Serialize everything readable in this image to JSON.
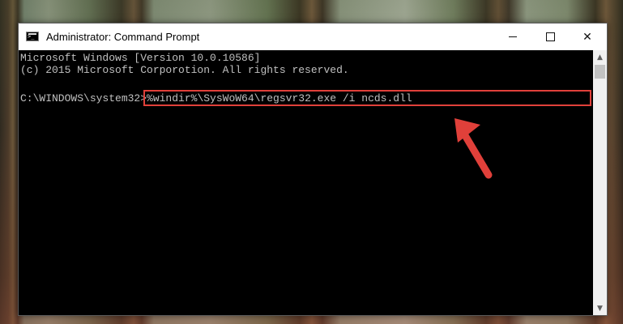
{
  "window": {
    "title": "Administrator: Command Prompt",
    "controls": {
      "minimize": "minimize",
      "maximize": "maximize",
      "close": "✕"
    }
  },
  "console": {
    "lines": [
      "Microsoft Windows [Version 10.0.10586]",
      "(c) 2015 Microsoft Corporotion. All rights reserved."
    ],
    "prompt": "C:\\WINDOWS\\system32>",
    "command": "%windir%\\SysWoW64\\regsvr32.exe /i ncds.dll"
  },
  "colors": {
    "console_bg": "#000000",
    "console_text": "#c0c0c0",
    "highlight_border": "#e0403a",
    "arrow": "#e0403a"
  },
  "icons": [
    "cmd-app-icon",
    "minimize-icon",
    "maximize-icon",
    "close-icon",
    "scroll-up-icon",
    "scroll-down-icon",
    "red-arrow-annotation"
  ]
}
